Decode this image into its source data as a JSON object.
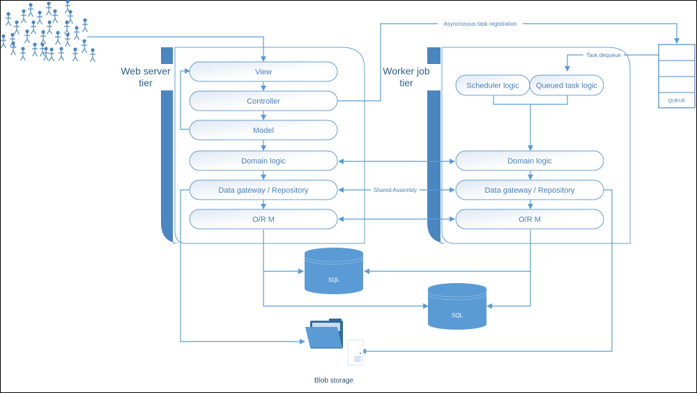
{
  "diagram": {
    "web_tier": {
      "label_line1": "Web server",
      "label_line2": "tier",
      "layers": [
        "View",
        "Controller",
        "Model",
        "Domain logic",
        "Data gateway / Repository",
        "O/R M"
      ]
    },
    "worker_tier": {
      "label_line1": "Worker job",
      "label_line2": "tier",
      "top_components": [
        "Scheduler logic",
        "Queued task logic"
      ],
      "layers": [
        "Domain logic",
        "Data gateway / Repository",
        "O/R M"
      ]
    },
    "edges": {
      "async_registration": "Asyncronous task registration",
      "task_dequeue": "Task dequeue",
      "shared_assembly": "Shared Assembly"
    },
    "queue": {
      "label": "QUEUE"
    },
    "databases": [
      {
        "label": "SQL"
      },
      {
        "label": "SQL"
      }
    ],
    "blob_storage": {
      "label": "Blob storage"
    },
    "users": {
      "label": "users-crowd"
    },
    "colors": {
      "primary": "#4a86c0",
      "line": "#5b9bd5",
      "dark": "#3f7bb0",
      "pill_border": "#6a9ccb"
    }
  }
}
